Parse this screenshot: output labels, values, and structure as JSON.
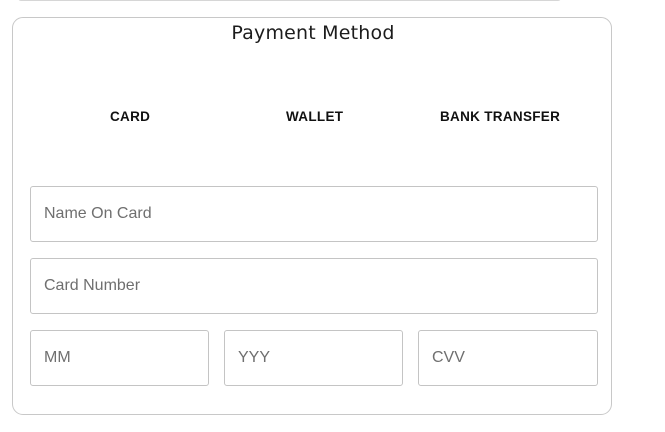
{
  "payment": {
    "title": "Payment Method",
    "tabs": [
      {
        "label": "CARD"
      },
      {
        "label": "WALLET"
      },
      {
        "label": "BANK TRANSFER"
      }
    ],
    "fields": {
      "name_on_card": {
        "placeholder": "Name On Card",
        "value": ""
      },
      "card_number": {
        "placeholder": "Card Number",
        "value": ""
      },
      "month": {
        "placeholder": "MM",
        "value": ""
      },
      "year": {
        "placeholder": "YYY",
        "value": ""
      },
      "cvv": {
        "placeholder": "CVV",
        "value": ""
      }
    }
  }
}
